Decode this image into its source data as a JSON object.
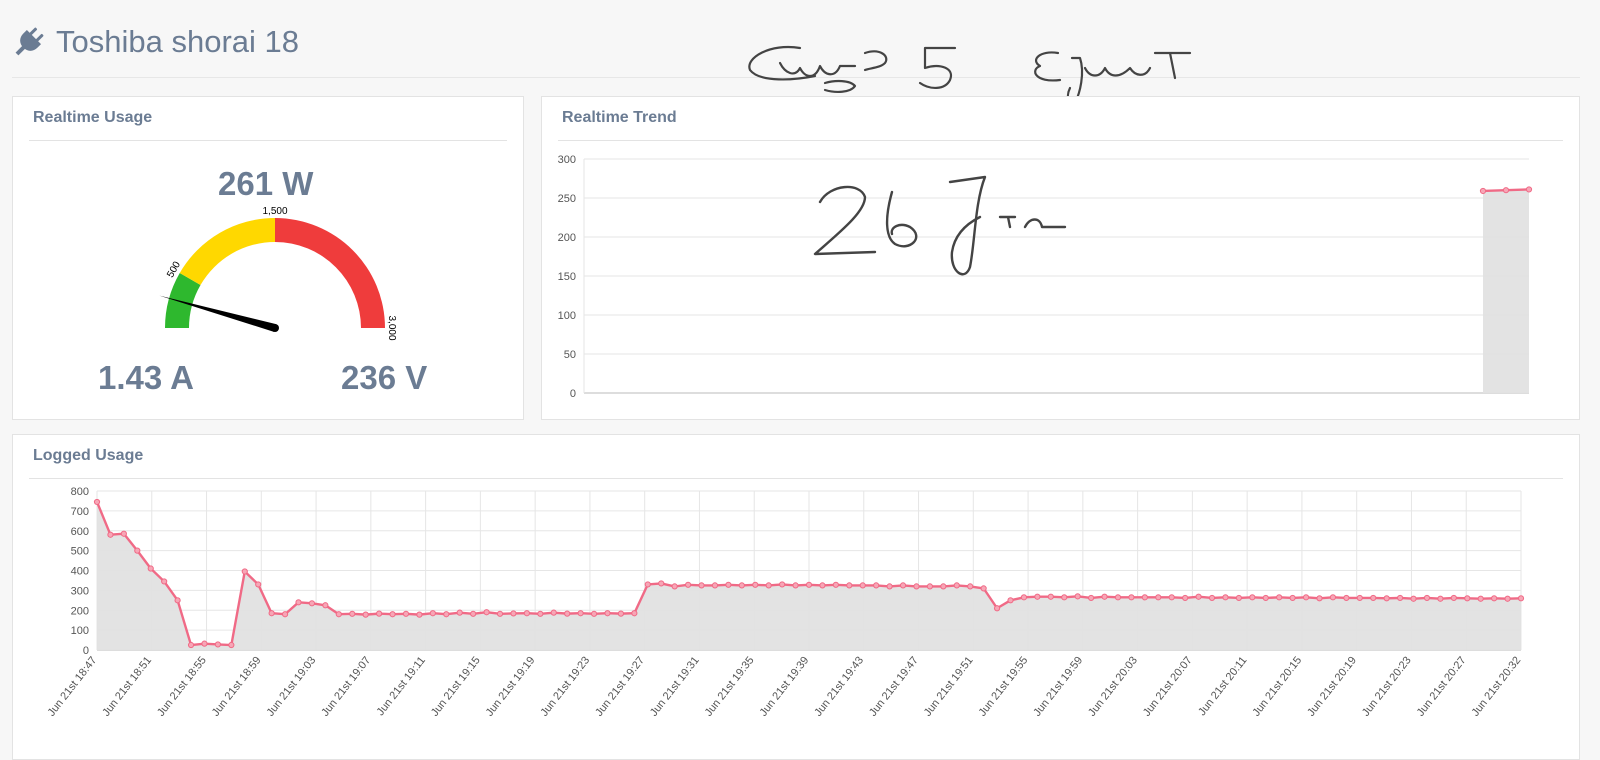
{
  "header": {
    "title": "Toshiba shorai 18",
    "icon": "plug-icon"
  },
  "realtime_usage": {
    "title": "Realtime Usage",
    "power": "261 W",
    "current": "1.43 A",
    "voltage": "236 V",
    "gauge": {
      "value": 261,
      "min": 0,
      "max": 3000,
      "ticks": [
        "500",
        "1,500",
        "3,000"
      ],
      "colors": {
        "green": "#2eb82e",
        "yellow": "#ffd800",
        "red": "#ef3c3c",
        "needle": "#000000"
      }
    }
  },
  "realtime_trend": {
    "title": "Realtime Trend"
  },
  "logged_usage": {
    "title": "Logged Usage"
  },
  "accent": {
    "line": "#f06a86",
    "fill": "#e2e2e2",
    "text": "#6b7c93"
  },
  "chart_data": [
    {
      "type": "area",
      "name": "realtime-trend",
      "ylim": [
        0,
        300
      ],
      "yticks": [
        "0",
        "50",
        "100",
        "150",
        "200",
        "250",
        "300"
      ],
      "x": [
        1,
        2,
        3
      ],
      "values": [
        259,
        260,
        261
      ],
      "x_tick_labels": [],
      "grid": true,
      "legend": "none"
    },
    {
      "type": "area",
      "name": "logged-usage",
      "ylim": [
        0,
        800
      ],
      "yticks": [
        "0",
        "100",
        "200",
        "300",
        "400",
        "500",
        "600",
        "700",
        "800"
      ],
      "x_tick_labels": [
        "Jun 21st 18:47",
        "Jun 21st 18:51",
        "Jun 21st 18:55",
        "Jun 21st 18:59",
        "Jun 21st 19:03",
        "Jun 21st 19:07",
        "Jun 21st 19:11",
        "Jun 21st 19:15",
        "Jun 21st 19:19",
        "Jun 21st 19:23",
        "Jun 21st 19:27",
        "Jun 21st 19:31",
        "Jun 21st 19:35",
        "Jun 21st 19:39",
        "Jun 21st 19:43",
        "Jun 21st 19:47",
        "Jun 21st 19:51",
        "Jun 21st 19:55",
        "Jun 21st 19:59",
        "Jun 21st 20:03",
        "Jun 21st 20:07",
        "Jun 21st 20:11",
        "Jun 21st 20:15",
        "Jun 21st 20:19",
        "Jun 21st 20:23",
        "Jun 21st 20:27",
        "Jun 21st 20:32"
      ],
      "values": [
        745,
        580,
        585,
        500,
        410,
        345,
        250,
        25,
        32,
        28,
        25,
        395,
        330,
        185,
        180,
        240,
        235,
        225,
        180,
        182,
        178,
        183,
        180,
        182,
        178,
        185,
        180,
        188,
        182,
        190,
        182,
        184,
        185,
        182,
        188,
        183,
        185,
        182,
        185,
        183,
        185,
        330,
        335,
        320,
        328,
        325,
        325,
        328,
        325,
        328,
        325,
        330,
        325,
        328,
        325,
        328,
        325,
        325,
        325,
        320,
        325,
        320,
        320,
        320,
        325,
        320,
        310,
        210,
        250,
        265,
        268,
        268,
        265,
        270,
        262,
        268,
        265,
        265,
        265,
        265,
        265,
        262,
        268,
        262,
        265,
        262,
        265,
        262,
        265,
        262,
        265,
        260,
        265,
        262,
        262,
        262,
        260,
        262,
        258,
        262,
        258,
        262,
        260,
        258,
        260,
        258,
        260
      ],
      "grid": true,
      "legend": "none"
    }
  ]
}
